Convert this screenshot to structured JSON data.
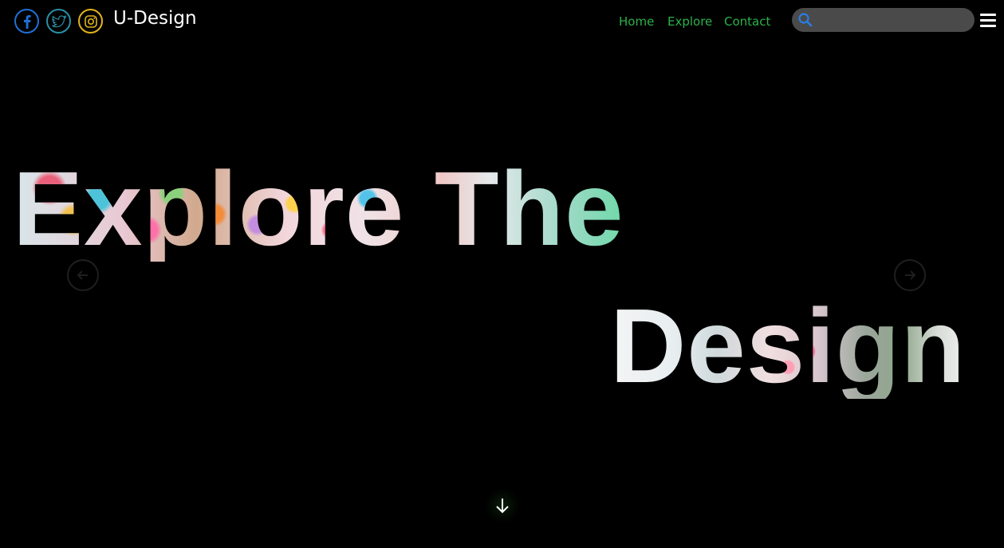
{
  "brand": {
    "name": "U-Design"
  },
  "social": [
    {
      "name": "facebook",
      "icon": "facebook-icon",
      "color": "#1f6fd6"
    },
    {
      "name": "twitter",
      "icon": "twitter-icon",
      "color": "#2a8fa6"
    },
    {
      "name": "instagram",
      "icon": "instagram-icon",
      "color": "#e1b21c"
    }
  ],
  "nav": {
    "items": [
      {
        "label": "Home"
      },
      {
        "label": "Explore"
      },
      {
        "label": "Contact"
      }
    ],
    "color": "#2bb24a"
  },
  "search": {
    "placeholder": "",
    "value": "",
    "icon": "search-icon",
    "icon_color": "#2a7de1"
  },
  "menu": {
    "icon": "hamburger-menu-icon"
  },
  "hero": {
    "line1": "Explore The",
    "line2": "Design"
  },
  "carousel": {
    "prev_icon": "arrow-left-icon",
    "next_icon": "arrow-right-icon"
  },
  "scroll": {
    "icon": "arrow-down-icon"
  }
}
